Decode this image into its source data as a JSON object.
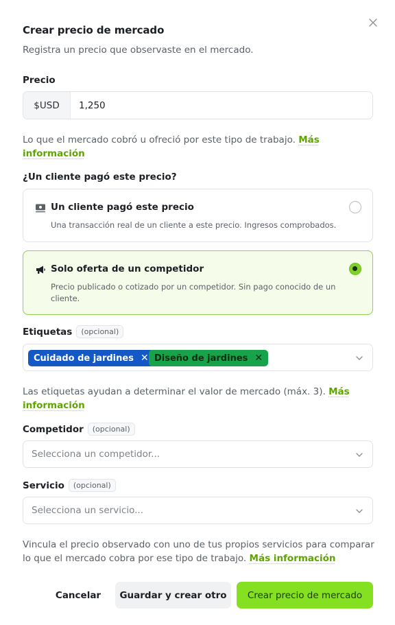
{
  "dialog": {
    "title": "Crear precio de mercado",
    "subtitle": "Registra un precio que observaste en el mercado."
  },
  "price": {
    "label": "Precio",
    "currency": "$USD",
    "value": "1,250",
    "help": "Lo que el mercado cobró u ofreció por este tipo de trabajo.",
    "help_link": "Más información"
  },
  "payment": {
    "label": "¿Un cliente pagó este precio?",
    "options": [
      {
        "title": "Un cliente pagó este precio",
        "description": "Una transacción real de un cliente a este precio. Ingresos comprobados.",
        "icon": "money-icon",
        "selected": false
      },
      {
        "title": "Solo oferta de un competidor",
        "description": "Precio publicado o cotizado por un competidor. Sin pago conocido de un cliente.",
        "icon": "megaphone-icon",
        "selected": true
      }
    ]
  },
  "tags": {
    "label": "Etiquetas",
    "optional": "(opcional)",
    "items": [
      {
        "label": "Cuidado de jardines",
        "color": "#1458c6"
      },
      {
        "label": "Diseño de jardines",
        "color": "#16a34a"
      }
    ],
    "help": "Las etiquetas ayudan a determinar el valor de mercado (máx. 3).",
    "help_link": "Más información"
  },
  "competitor": {
    "label": "Competidor",
    "optional": "(opcional)",
    "placeholder": "Selecciona un competidor..."
  },
  "service": {
    "label": "Servicio",
    "optional": "(opcional)",
    "placeholder": "Selecciona un servicio...",
    "help": "Vincula el precio observado con uno de tus propios servicios para comparar lo que el mercado cobra por ese tipo de trabajo.",
    "help_link": "Más información"
  },
  "actions": {
    "cancel": "Cancelar",
    "save_and_new": "Guardar y crear otro",
    "create": "Crear precio de mercado"
  },
  "colors": {
    "accent": "#84e021",
    "link": "#5ea500",
    "selected_bg": "#f5fce9"
  }
}
